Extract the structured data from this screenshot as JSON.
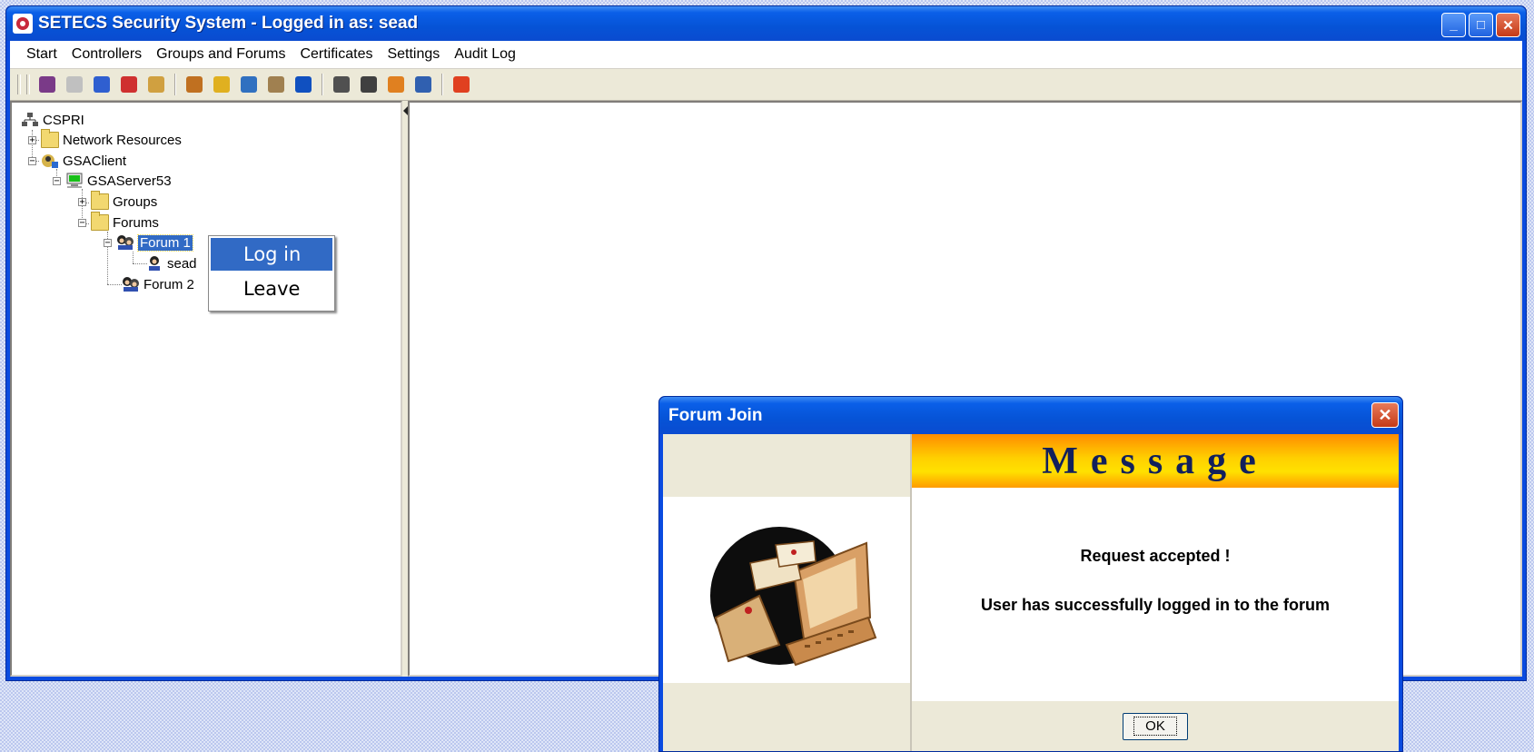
{
  "window": {
    "title": "SETECS Security System - Logged in as: sead"
  },
  "menu": {
    "items": [
      "Start",
      "Controllers",
      "Groups and Forums",
      "Certificates",
      "Settings",
      "Audit Log"
    ]
  },
  "toolbar": {
    "colors": [
      "#7a3a88",
      "#c0c0c0",
      "#2f5fd0",
      "#cf3030",
      "#d0a040",
      "#c07020",
      "#e0b020",
      "#3070c0",
      "#a08050",
      "#1050c0",
      "#505050",
      "#404040",
      "#e08020",
      "#3060b0",
      "#e04020"
    ]
  },
  "tree": {
    "root": "CSPRI",
    "network_resources": "Network Resources",
    "client": "GSAClient",
    "server": "GSAServer53",
    "groups": "Groups",
    "forums": "Forums",
    "forum1": "Forum 1",
    "user": "sead",
    "forum2": "Forum 2"
  },
  "context_menu": {
    "login": "Log in",
    "leave": "Leave"
  },
  "dialog": {
    "title": "Forum Join",
    "banner": "Message",
    "line1": "Request accepted !",
    "line2": "User has successfully logged in to the forum",
    "ok": "OK"
  }
}
